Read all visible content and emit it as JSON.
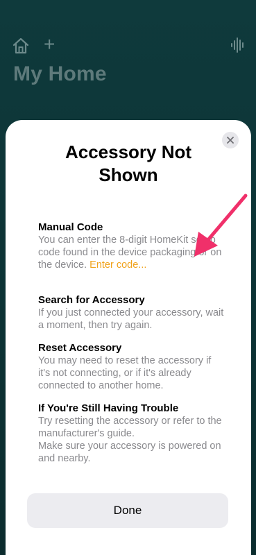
{
  "background": {
    "title": "My Home",
    "add_symbol": "+"
  },
  "sheet": {
    "title": "Accessory Not Shown",
    "sections": [
      {
        "heading": "Manual Code",
        "body": "You can enter the 8-digit HomeKit setup code found in the device packaging or on the device.",
        "link": "Enter code..."
      },
      {
        "heading": "Search for Accessory",
        "body": "If you just connected your accessory, wait a moment, then try again."
      },
      {
        "heading": "Reset Accessory",
        "body": "You may need to reset the accessory if it's not connecting, or if it's already connected to another home."
      },
      {
        "heading": "If You're Still Having Trouble",
        "body": "Try resetting the accessory or refer to the manufacturer's guide.",
        "body2": "Make sure your accessory is powered on and nearby."
      }
    ],
    "done_label": "Done"
  },
  "colors": {
    "link": "#f0a21a",
    "annotation_arrow": "#f0306a",
    "background": "#0f3a3c"
  },
  "icons": [
    "home-icon",
    "plus-icon",
    "waveform-icon",
    "close-icon",
    "arrow-annotation"
  ]
}
